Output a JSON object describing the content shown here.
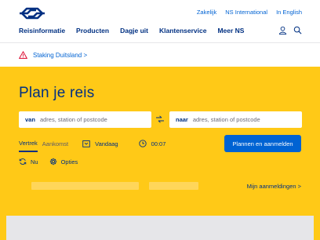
{
  "header": {
    "utility_links": [
      "Zakelijk",
      "NS International",
      "In English"
    ],
    "main_nav": [
      "Reisinformatie",
      "Producten",
      "Dagje uit",
      "Klantenservice",
      "Meer NS"
    ]
  },
  "alert": {
    "text": "Staking Duitsland >"
  },
  "planner": {
    "title": "Plan je reis",
    "van_label": "van",
    "van_placeholder": "adres, station of postcode",
    "naar_label": "naar",
    "naar_placeholder": "adres, station of postcode",
    "tab_vertrek": "Vertrek",
    "tab_aankomst": "Aankomst",
    "date": "Vandaag",
    "time": "00:07",
    "submit": "Plannen en aanmelden",
    "now": "Nu",
    "options": "Opties",
    "mijn_aanmeldingen": "Mijn aanmeldingen >"
  },
  "colors": {
    "brand_yellow": "#ffc917",
    "ns_blue": "#003082",
    "link_blue": "#0063d3"
  }
}
